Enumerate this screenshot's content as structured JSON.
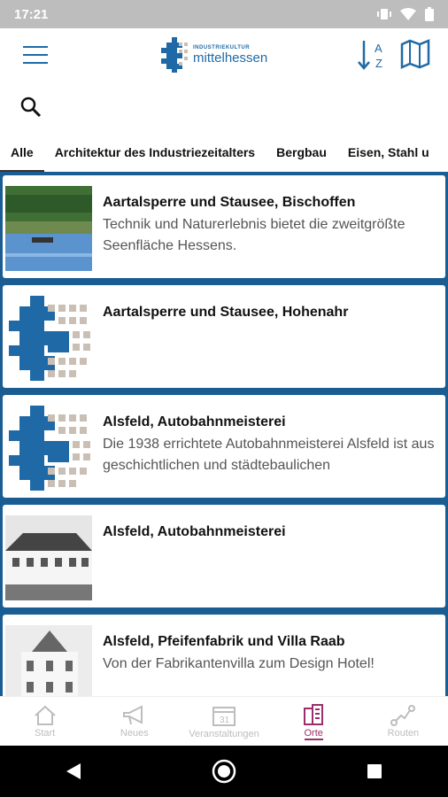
{
  "status": {
    "time": "17:21"
  },
  "header": {
    "logo_small": "INDUSTRIEKULTUR",
    "logo_big": "mittelhessen",
    "sort_letters": "A Z"
  },
  "tabs": [
    {
      "label": "Alle",
      "active": true
    },
    {
      "label": "Architektur des Industriezeitalters"
    },
    {
      "label": "Bergbau"
    },
    {
      "label": "Eisen, Stahl u"
    }
  ],
  "items": [
    {
      "title": "Aartalsperre und Stausee, Bischoffen",
      "desc": "Technik und Naturerlebnis bietet die zweitgrößte Seenfläche Hessens.",
      "thumb": "lake-photo"
    },
    {
      "title": "Aartalsperre und Stausee, Hohenahr",
      "desc": "",
      "thumb": "logo-placeholder"
    },
    {
      "title": "Alsfeld, Autobahnmeisterei",
      "desc": "Die 1938 errichtete Autobahnmeisterei Alsfeld ist aus geschichtlichen und städtebaulichen",
      "thumb": "logo-placeholder"
    },
    {
      "title": "Alsfeld, Autobahnmeisterei",
      "desc": "",
      "thumb": "building-photo"
    },
    {
      "title": "Alsfeld, Pfeifenfabrik und Villa Raab",
      "desc": "Von der Fabrikantenvilla zum Design Hotel!",
      "thumb": "villa-photo"
    }
  ],
  "nav": [
    {
      "label": "Start",
      "icon": "home-icon"
    },
    {
      "label": "Neues",
      "icon": "megaphone-icon"
    },
    {
      "label": "Veranstaltungen",
      "icon": "calendar-icon",
      "day": "31"
    },
    {
      "label": "Orte",
      "icon": "buildings-icon",
      "active": true
    },
    {
      "label": "Routen",
      "icon": "route-icon"
    }
  ],
  "colors": {
    "brand": "#1f6aa6",
    "list_bg": "#1a5d93",
    "active_nav": "#9b2d6c"
  }
}
